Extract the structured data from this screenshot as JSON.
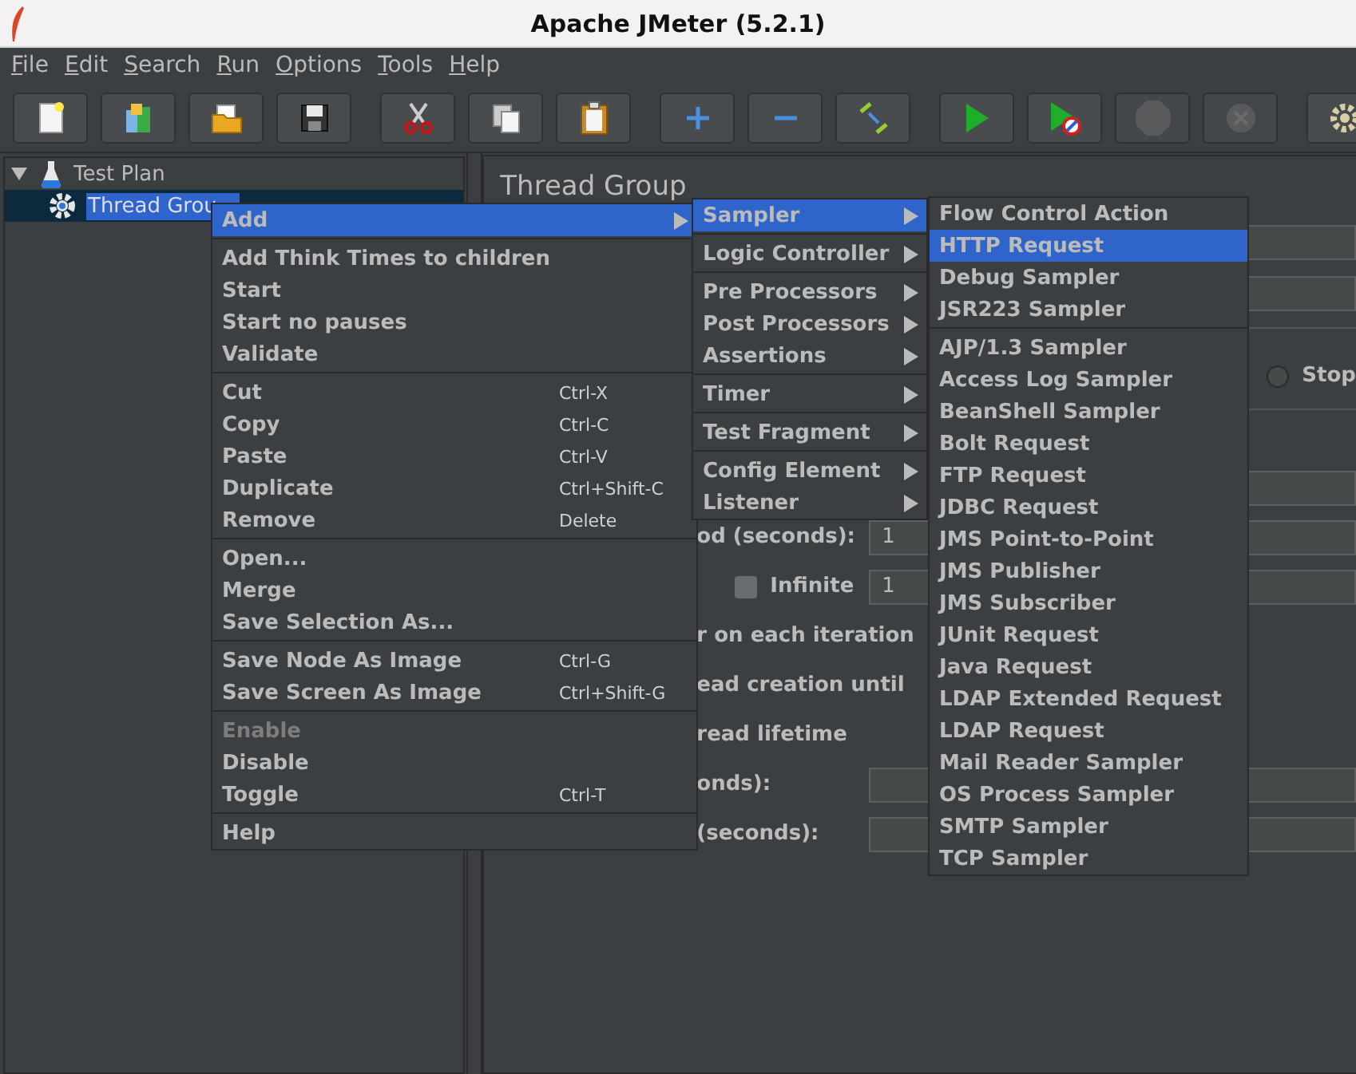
{
  "window": {
    "title": "Apache JMeter (5.2.1)"
  },
  "menu_bar": [
    "File",
    "Edit",
    "Search",
    "Run",
    "Options",
    "Tools",
    "Help"
  ],
  "toolbar": [
    [
      {
        "kind": "new",
        "disabled": false
      },
      {
        "kind": "templates",
        "disabled": false
      },
      {
        "kind": "open",
        "disabled": false
      },
      {
        "kind": "save",
        "disabled": false
      }
    ],
    [
      {
        "kind": "cut",
        "disabled": false
      },
      {
        "kind": "copy",
        "disabled": false
      },
      {
        "kind": "paste",
        "disabled": false
      }
    ],
    [
      {
        "kind": "expand",
        "disabled": false
      },
      {
        "kind": "collapse",
        "disabled": false
      },
      {
        "kind": "toggle",
        "disabled": false
      }
    ],
    [
      {
        "kind": "start",
        "disabled": false
      },
      {
        "kind": "start_no_pauses",
        "disabled": false
      },
      {
        "kind": "stop",
        "disabled": true
      },
      {
        "kind": "shutdown",
        "disabled": true
      }
    ],
    [
      {
        "kind": "clear",
        "disabled": false
      }
    ]
  ],
  "tree": [
    {
      "label": "Test Plan",
      "kind": "plan",
      "expanded": true,
      "selected": false,
      "children": [
        {
          "label": "Thread Grou",
          "kind": "thread_group",
          "selected": true
        }
      ]
    }
  ],
  "thread_group": {
    "title": "Thread Group",
    "sections": [
      [
        {
          "kind": "field"
        },
        {
          "kind": "field"
        }
      ],
      [
        {
          "kind": "radio",
          "label": "Stop",
          "selected": false
        }
      ],
      [
        {
          "kind": "field"
        },
        {
          "kind": "labeled_field",
          "label": "od (seconds):",
          "value": "1"
        },
        {
          "kind": "check_field",
          "label": "Infinite",
          "checked": false,
          "value": "1"
        },
        {
          "kind": "label",
          "label": "r on each iteration"
        },
        {
          "kind": "label",
          "label": "ead creation until"
        },
        {
          "kind": "label",
          "label": "read lifetime"
        },
        {
          "kind": "labeled_field",
          "label": "onds):"
        },
        {
          "kind": "labeled_field",
          "label": "(seconds):"
        }
      ]
    ]
  },
  "context_menu": {
    "groups": [
      [
        {
          "label": "Add",
          "selected": true,
          "disabled": false,
          "submenu": true
        }
      ],
      [
        {
          "label": "Add Think Times to children",
          "selected": false,
          "disabled": false,
          "submenu": false
        },
        {
          "label": "Start",
          "selected": false,
          "disabled": false,
          "submenu": false
        },
        {
          "label": "Start no pauses",
          "selected": false,
          "disabled": false,
          "submenu": false
        },
        {
          "label": "Validate",
          "selected": false,
          "disabled": false,
          "submenu": false
        }
      ],
      [
        {
          "label": "Cut",
          "shortcut": "Ctrl-X",
          "selected": false,
          "disabled": false,
          "submenu": false
        },
        {
          "label": "Copy",
          "shortcut": "Ctrl-C",
          "selected": false,
          "disabled": false,
          "submenu": false
        },
        {
          "label": "Paste",
          "shortcut": "Ctrl-V",
          "selected": false,
          "disabled": false,
          "submenu": false
        },
        {
          "label": "Duplicate",
          "shortcut": "Ctrl+Shift-C",
          "selected": false,
          "disabled": false,
          "submenu": false
        },
        {
          "label": "Remove",
          "shortcut": "Delete",
          "selected": false,
          "disabled": false,
          "submenu": false
        }
      ],
      [
        {
          "label": "Open...",
          "selected": false,
          "disabled": false,
          "submenu": false
        },
        {
          "label": "Merge",
          "selected": false,
          "disabled": false,
          "submenu": false
        },
        {
          "label": "Save Selection As...",
          "selected": false,
          "disabled": false,
          "submenu": false
        }
      ],
      [
        {
          "label": "Save Node As Image",
          "shortcut": "Ctrl-G",
          "selected": false,
          "disabled": false,
          "submenu": false
        },
        {
          "label": "Save Screen As Image",
          "shortcut": "Ctrl+Shift-G",
          "selected": false,
          "disabled": false,
          "submenu": false
        }
      ],
      [
        {
          "label": "Enable",
          "selected": false,
          "disabled": true,
          "submenu": false
        },
        {
          "label": "Disable",
          "selected": false,
          "disabled": false,
          "submenu": false
        },
        {
          "label": "Toggle",
          "shortcut": "Ctrl-T",
          "selected": false,
          "disabled": false,
          "submenu": false
        }
      ],
      [
        {
          "label": "Help",
          "selected": false,
          "disabled": false,
          "submenu": false
        }
      ]
    ]
  },
  "add_menu": {
    "groups": [
      [
        {
          "label": "Sampler",
          "selected": true,
          "submenu": true
        }
      ],
      [
        {
          "label": "Logic Controller",
          "selected": false,
          "submenu": true
        }
      ],
      [
        {
          "label": "Pre Processors",
          "selected": false,
          "submenu": true
        },
        {
          "label": "Post Processors",
          "selected": false,
          "submenu": true
        },
        {
          "label": "Assertions",
          "selected": false,
          "submenu": true
        }
      ],
      [
        {
          "label": "Timer",
          "selected": false,
          "submenu": true
        }
      ],
      [
        {
          "label": "Test Fragment",
          "selected": false,
          "submenu": true
        }
      ],
      [
        {
          "label": "Config Element",
          "selected": false,
          "submenu": true
        },
        {
          "label": "Listener",
          "selected": false,
          "submenu": true
        }
      ]
    ]
  },
  "sampler_menu": {
    "groups": [
      [
        {
          "label": "Flow Control Action",
          "selected": false
        },
        {
          "label": "HTTP Request",
          "selected": true
        },
        {
          "label": "Debug Sampler",
          "selected": false
        },
        {
          "label": "JSR223 Sampler",
          "selected": false
        }
      ],
      [
        {
          "label": "AJP/1.3 Sampler",
          "selected": false
        },
        {
          "label": "Access Log Sampler",
          "selected": false
        },
        {
          "label": "BeanShell Sampler",
          "selected": false
        },
        {
          "label": "Bolt Request",
          "selected": false
        },
        {
          "label": "FTP Request",
          "selected": false
        },
        {
          "label": "JDBC Request",
          "selected": false
        },
        {
          "label": "JMS Point-to-Point",
          "selected": false
        },
        {
          "label": "JMS Publisher",
          "selected": false
        },
        {
          "label": "JMS Subscriber",
          "selected": false
        },
        {
          "label": "JUnit Request",
          "selected": false
        },
        {
          "label": "Java Request",
          "selected": false
        },
        {
          "label": "LDAP Extended Request",
          "selected": false
        },
        {
          "label": "LDAP Request",
          "selected": false
        },
        {
          "label": "Mail Reader Sampler",
          "selected": false
        },
        {
          "label": "OS Process Sampler",
          "selected": false
        },
        {
          "label": "SMTP Sampler",
          "selected": false
        },
        {
          "label": "TCP Sampler",
          "selected": false
        }
      ]
    ]
  }
}
